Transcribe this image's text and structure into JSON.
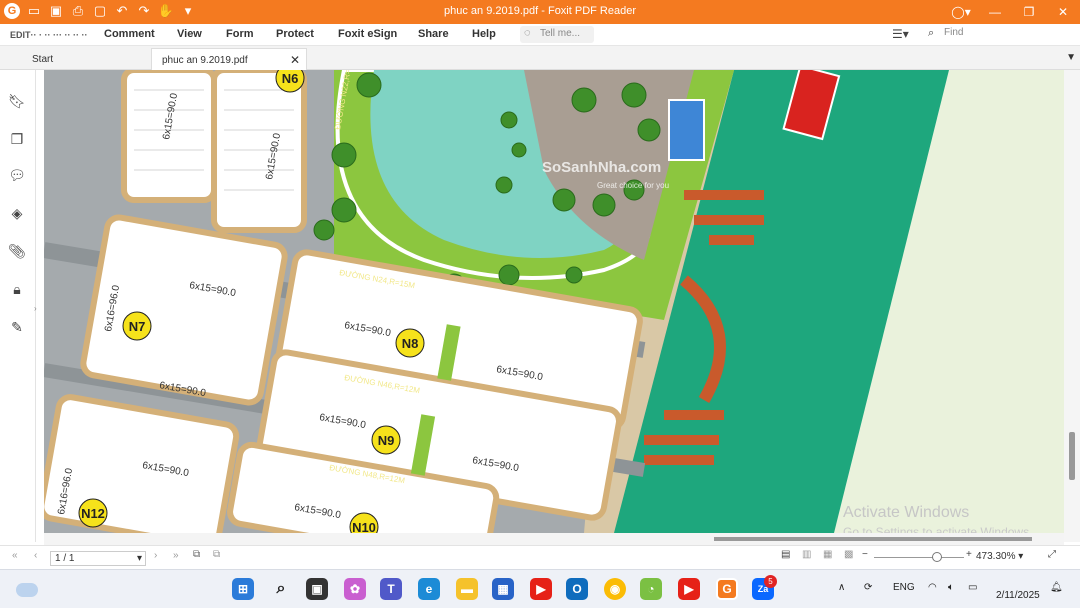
{
  "window": {
    "title": "phuc an 9.2019.pdf - Foxit PDF Reader"
  },
  "menu": {
    "items": [
      "Comment",
      "View",
      "Form",
      "Protect",
      "Foxit eSign",
      "Share",
      "Help"
    ],
    "home_garbled": "EDIT·· · ·· ··· ·· ·· ··",
    "tell_me": "Tell me...",
    "find_placeholder": "Find"
  },
  "tabs": {
    "start": "Start",
    "file": "phuc an 9.2019.pdf"
  },
  "map": {
    "blocks": [
      "N6",
      "N7",
      "N8",
      "N9",
      "N10",
      "N12"
    ],
    "lot_size": "6x15=90.0",
    "lot_size_alt": "6x16=96.0",
    "roads": [
      "ĐƯỜNG N24,R=15M",
      "ĐƯỜNG N46,R=12M",
      "ĐƯỜNG N48,R=12M",
      "ĐƯỜNG N22,R=15M"
    ],
    "logo_text": "SoSanhNha.com",
    "logo_tagline": "Great choice for you"
  },
  "status": {
    "page": "1 / 1",
    "zoom": "473.30%"
  },
  "taskbar": {
    "time": "",
    "date": "2/11/2025",
    "lang": "ENG",
    "badge": "5",
    "app_label": "Za"
  },
  "watermark": {
    "line1": "Activate Windows",
    "line2": "Go to Settings to activate Windows."
  },
  "colors": {
    "accent": "#f47a20",
    "water": "#1ea77d",
    "lake": "#7fd3c3",
    "grass": "#8cc63f",
    "road": "#9aa0a3"
  }
}
